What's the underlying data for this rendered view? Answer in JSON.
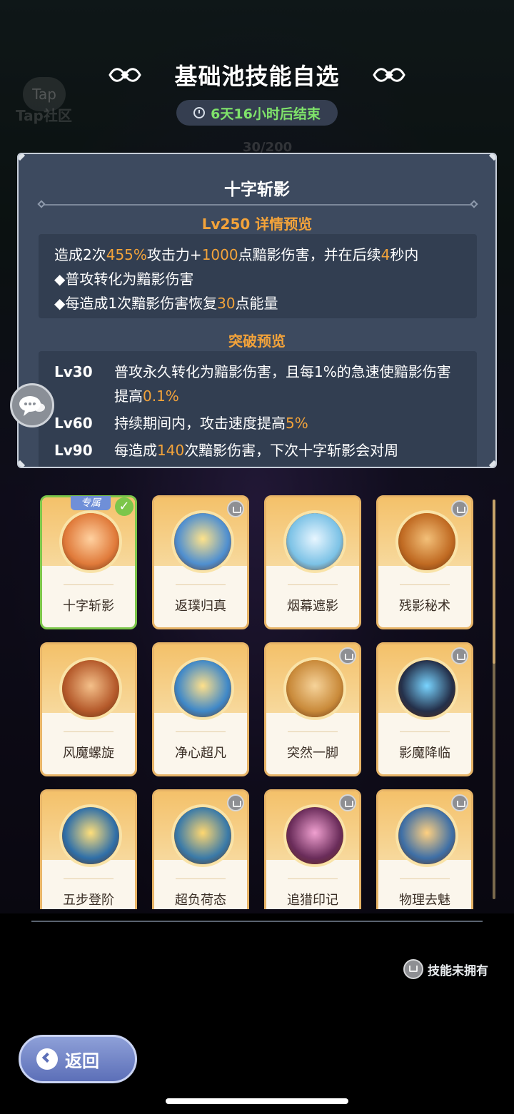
{
  "header": {
    "title": "基础池技能自选",
    "timer": "6天16小时后结束"
  },
  "background": {
    "tap_logo": "Tap",
    "tap_community": "Tap社区",
    "counter": "30/200"
  },
  "detail": {
    "skill_name": "十字斩影",
    "preview_title": "Lv250  详情预览",
    "desc_lines": [
      {
        "parts": [
          "造成2次",
          "455%",
          "攻击力+",
          "1000",
          "点黯影伤害，并在后续",
          "4",
          "秒内"
        ]
      },
      {
        "parts": [
          "◆普攻转化为黯影伤害"
        ]
      },
      {
        "parts": [
          "◆每造成1次黯影伤害恢复",
          "30",
          "点能量"
        ]
      }
    ],
    "breakthrough_title": "突破预览",
    "breakthroughs": [
      {
        "level": "Lv30",
        "text_a": "普攻永久转化为黯影伤害，且每1%的急速使黯影伤害提高",
        "value": "0.1%",
        "text_b": ""
      },
      {
        "level": "Lv60",
        "text_a": "持续期间内，攻击速度提高",
        "value": "5%",
        "text_b": ""
      },
      {
        "level": "Lv90",
        "text_a": "每造成",
        "value": "140",
        "text_b": "次黯影伤害，下次十字斩影会对周"
      }
    ]
  },
  "skills": [
    {
      "name": "十字斩影",
      "selected": true,
      "exclusive_tag": "专属",
      "owned": true
    },
    {
      "name": "返璞归真",
      "selected": false,
      "owned": false
    },
    {
      "name": "烟幕遮影",
      "selected": false,
      "owned": true
    },
    {
      "name": "残影秘术",
      "selected": false,
      "owned": false
    },
    {
      "name": "风魔螺旋",
      "selected": false,
      "owned": true
    },
    {
      "name": "净心超凡",
      "selected": false,
      "owned": true
    },
    {
      "name": "突然一脚",
      "selected": false,
      "owned": false
    },
    {
      "name": "影魔降临",
      "selected": false,
      "owned": false
    },
    {
      "name": "五步登阶",
      "selected": false,
      "owned": true
    },
    {
      "name": "超负荷态",
      "selected": false,
      "owned": false
    },
    {
      "name": "追猎印记",
      "selected": false,
      "owned": false
    },
    {
      "name": "物理去魅",
      "selected": false,
      "owned": false
    }
  ],
  "legend": {
    "label": "技能未拥有"
  },
  "back_button": {
    "label": "返回"
  },
  "colors": {
    "accent": "#f3a33a",
    "timer_green": "#7fe36a",
    "panel": "#3d4a5f",
    "selected_border": "#7cc64a"
  }
}
